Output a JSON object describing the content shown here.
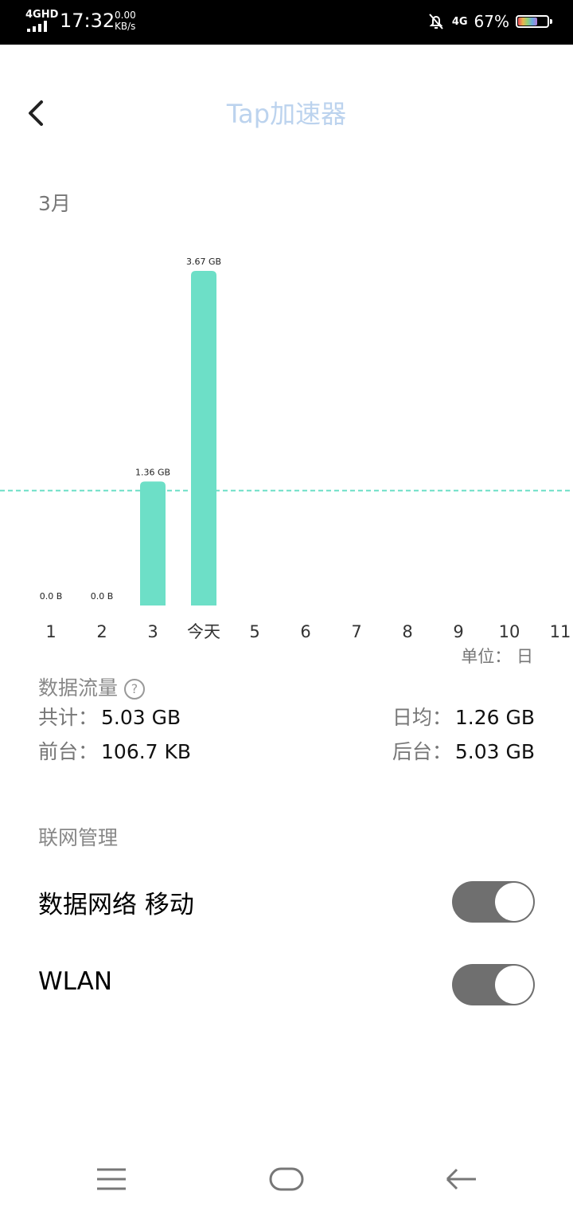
{
  "status_bar": {
    "network": "4GHD",
    "time": "17:32",
    "speed_value": "0.00",
    "speed_unit": "KB/s",
    "mobile_net": "4G",
    "battery": "67%",
    "battery_level": 0.67
  },
  "header": {
    "title": "Tap加速器",
    "back_icon": "chevron-left-icon"
  },
  "month_label": "3月",
  "chart_data": {
    "type": "bar",
    "categories": [
      "1",
      "2",
      "3",
      "今天",
      "5",
      "6",
      "7",
      "8",
      "9",
      "10",
      "11"
    ],
    "values_gb": [
      0,
      0,
      1.36,
      3.67,
      null,
      null,
      null,
      null,
      null,
      null,
      null
    ],
    "data_labels": [
      "0.0 B",
      "0.0 B",
      "1.36 GB",
      "3.67 GB",
      "",
      "",
      "",
      "",
      "",
      "",
      ""
    ],
    "reference_line_gb": 1.26,
    "bar_color": "#6ddfc7",
    "reference_line_color": "#6ddfc7",
    "ylim": [
      0,
      3.67
    ]
  },
  "unit_label": "单位：  日",
  "traffic": {
    "title": "数据流量",
    "help_icon": "question-circle-icon",
    "total_label": "共计：",
    "total_value": "5.03 GB",
    "daily_label": "日均：",
    "daily_value": "1.26 GB",
    "foreground_label": "前台：",
    "foreground_value": "106.7 KB",
    "background_label": "后台：",
    "background_value": "5.03 GB"
  },
  "network_mgmt": {
    "title": "联网管理",
    "items": [
      {
        "label": "数据网络 移动",
        "enabled": true
      },
      {
        "label": "WLAN",
        "enabled": true
      }
    ]
  },
  "navbar": {
    "menu_icon": "menu-icon",
    "home_icon": "home-icon",
    "back_icon": "back-arrow-icon"
  },
  "colors": {
    "accent": "#6ddfc7",
    "title": "#bcd3ee",
    "toggle": "#6f6f6f"
  }
}
